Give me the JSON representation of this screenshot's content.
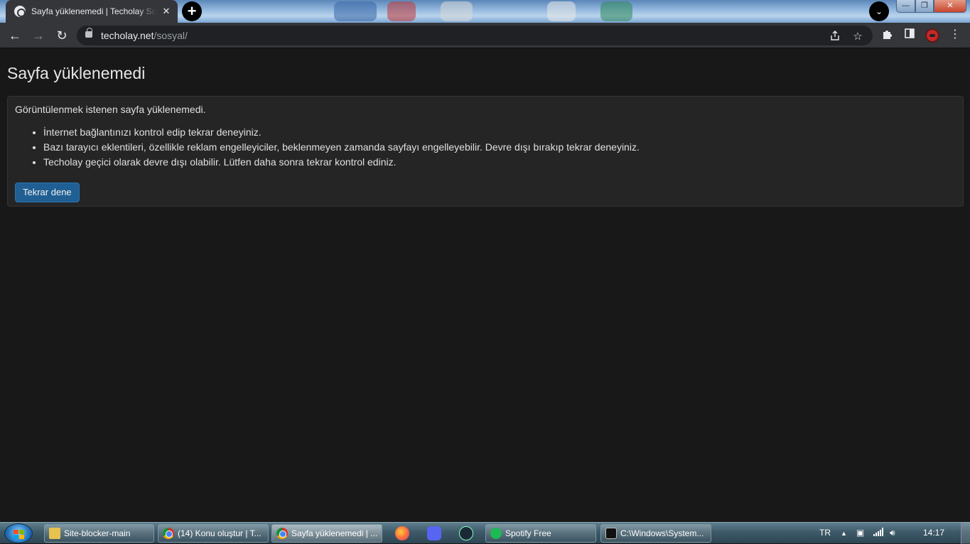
{
  "browser": {
    "tab_title": "Sayfa yüklenemedi | Techolay Sosyal",
    "tab_close": "✕",
    "new_tab": "+",
    "tab_search": "⌄",
    "win_min": "—",
    "win_max": "❐",
    "win_close": "✕",
    "back": "←",
    "forward": "→",
    "reload": "↻",
    "url_host": "techolay.net",
    "url_path": "/sosyal/",
    "icons": [
      "share-icon",
      "star-icon",
      "extensions-icon",
      "side-panel-icon",
      "profile-avatar",
      "menu-icon"
    ]
  },
  "page": {
    "title": "Sayfa yüklenemedi",
    "lead": "Görüntülenmek istenen sayfa yüklenemedi.",
    "reasons": [
      "İnternet bağlantınızı kontrol edip tekrar deneyiniz.",
      "Bazı tarayıcı eklentileri, özellikle reklam engelleyiciler, beklenmeyen zamanda sayfayı engelleyebilir. Devre dışı bırakıp tekrar deneyiniz.",
      "Techolay geçici olarak devre dışı olabilir. Lütfen daha sonra tekrar kontrol ediniz."
    ],
    "retry_button": "Tekrar dene",
    "colors": {
      "background": "#181818",
      "card": "#252525",
      "button": "#1f5f93"
    }
  },
  "taskbar": {
    "tasks": [
      "Site-blocker-main",
      "(14) Konu oluştur | T...",
      "Sayfa yüklenemedi | ...",
      "Spotify Free",
      "C:\\Windows\\System..."
    ],
    "quick_launch": [
      "firefox-icon",
      "discord-icon",
      "steam-icon"
    ],
    "language": "TR",
    "time": "14:17"
  }
}
